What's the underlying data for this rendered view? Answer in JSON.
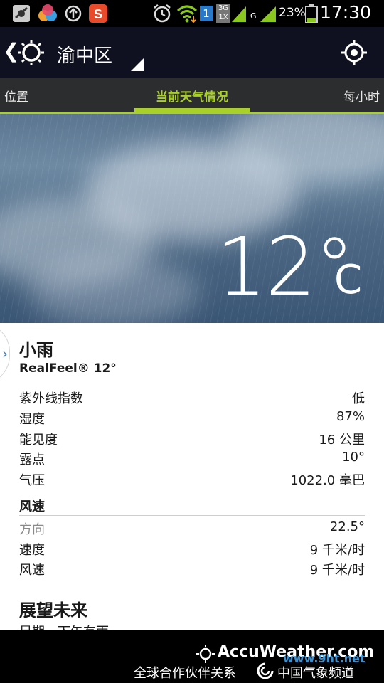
{
  "status_bar": {
    "battery_percent": "23%",
    "network_1": "3G",
    "network_2": "1X",
    "network_g": "G",
    "sim_number": "1",
    "time": "17:30"
  },
  "action_bar": {
    "location": "渝中区"
  },
  "tabs": [
    {
      "label": "位置"
    },
    {
      "label": "当前天气情况"
    },
    {
      "label": "每小时"
    }
  ],
  "current": {
    "temperature": "12°",
    "unit": "C",
    "condition": "小雨",
    "realfeel": "RealFeel® 12°"
  },
  "details": [
    {
      "label": "紫外线指数",
      "value": "低"
    },
    {
      "label": "湿度",
      "value": "87%"
    },
    {
      "label": "能见度",
      "value": "16 公里"
    },
    {
      "label": "露点",
      "value": "10°"
    },
    {
      "label": "气压",
      "value": "1022.0 毫巴"
    }
  ],
  "wind": {
    "header": "风速",
    "rows": [
      {
        "label": "方向",
        "value": "22.5°"
      },
      {
        "label": "速度",
        "value": "9 千米/时"
      },
      {
        "label": "风速",
        "value": "9 千米/时"
      }
    ]
  },
  "outlook": {
    "title": "展望未来",
    "text": "星期一下午有雨"
  },
  "footer": {
    "brand": "AccuWeather.com",
    "partner": "全球合作伙伴关系",
    "cma": "中国气象频道",
    "watermark": "www.9ht.net"
  },
  "colors": {
    "accent_green": "#a8d028",
    "action_bar_bg": "#0f1120",
    "tab_bar_bg": "#2c2d2f"
  }
}
